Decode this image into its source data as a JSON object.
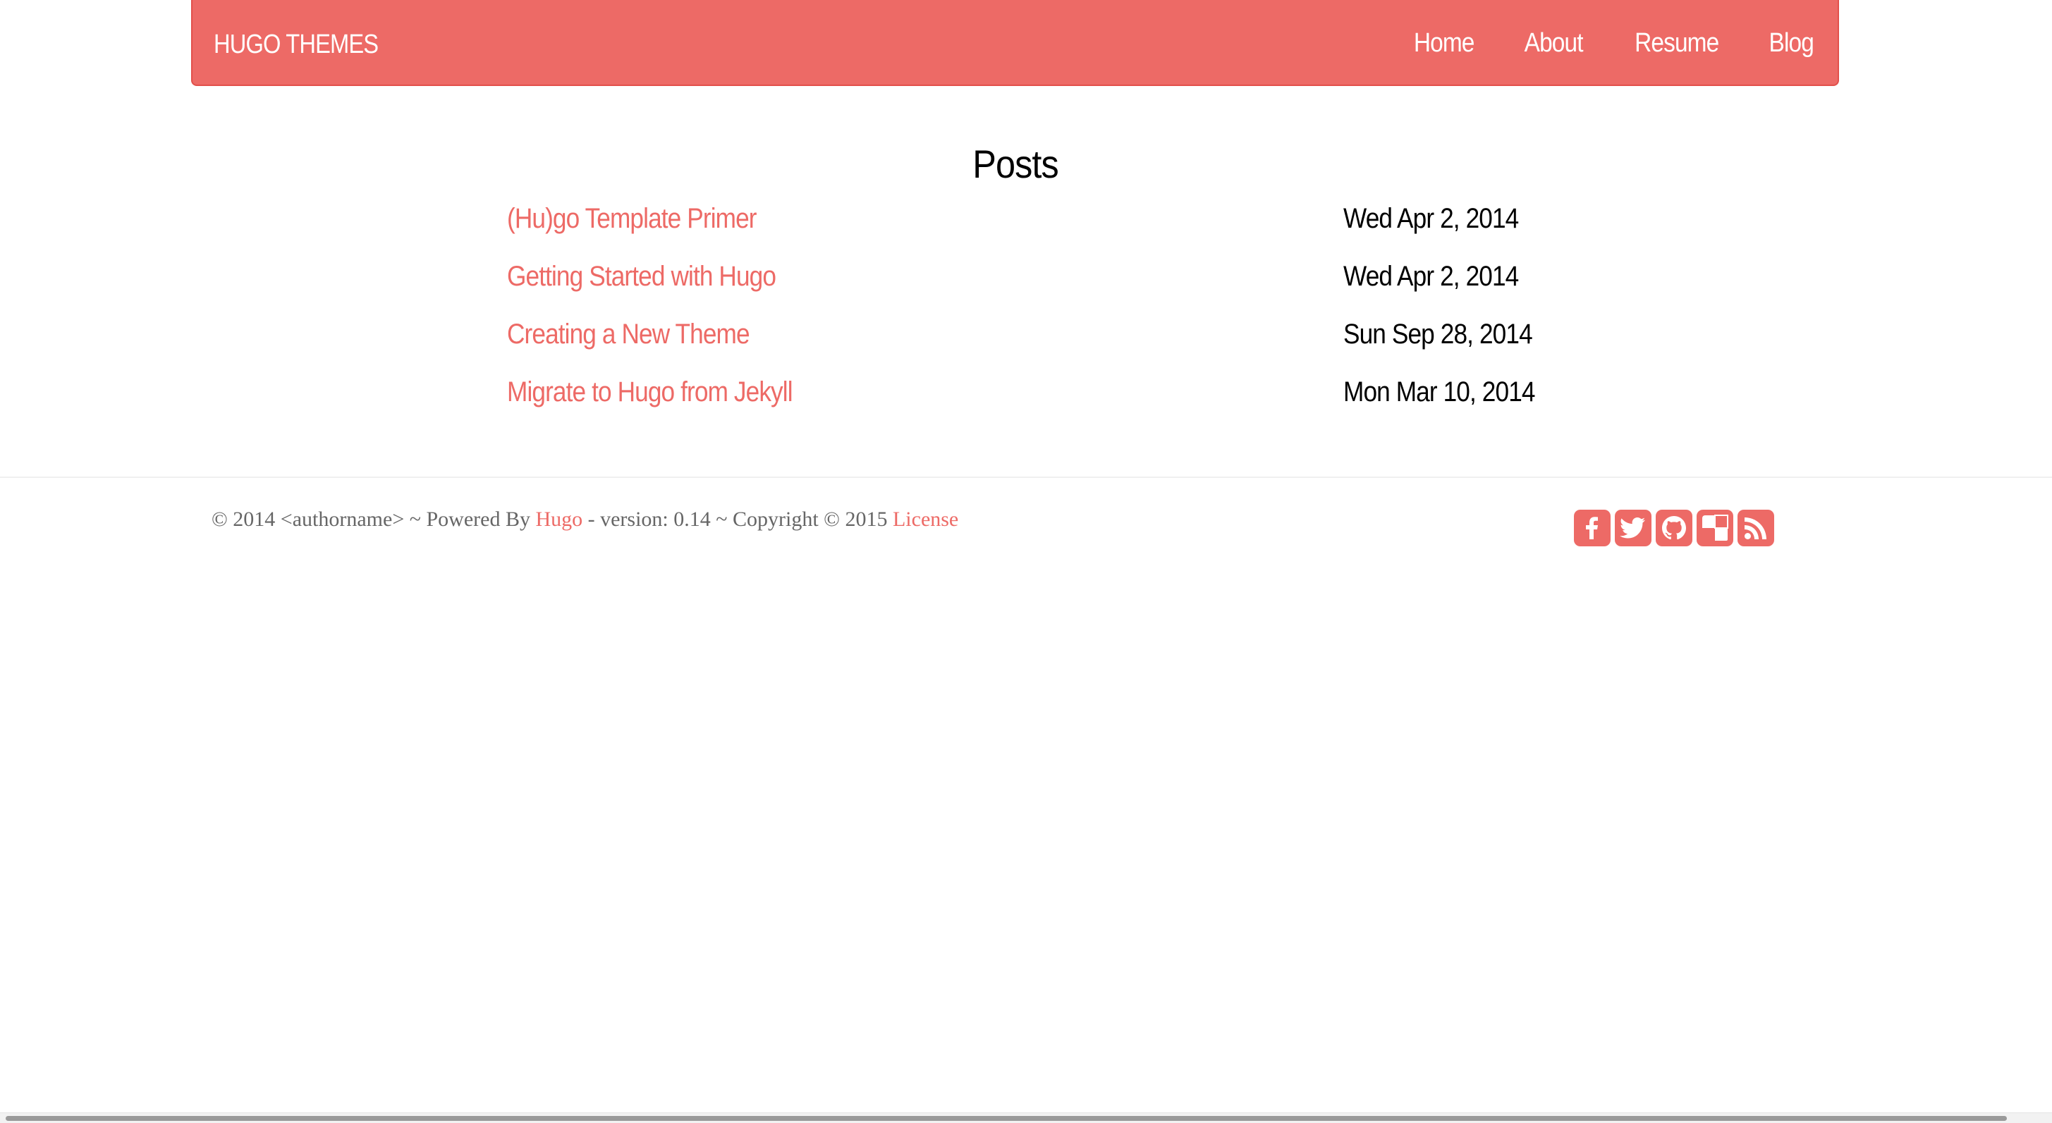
{
  "header": {
    "brand": "HUGO THEMES",
    "nav": [
      {
        "label": "Home"
      },
      {
        "label": "About"
      },
      {
        "label": "Resume"
      },
      {
        "label": "Blog"
      }
    ]
  },
  "main": {
    "title": "Posts",
    "posts": [
      {
        "title": "(Hu)go Template Primer",
        "date": "Wed Apr 2, 2014"
      },
      {
        "title": "Getting Started with Hugo",
        "date": "Wed Apr 2, 2014"
      },
      {
        "title": "Creating a New Theme",
        "date": "Sun Sep 28, 2014"
      },
      {
        "title": "Migrate to Hugo from Jekyll",
        "date": "Mon Mar 10, 2014"
      }
    ]
  },
  "footer": {
    "text_before": "© 2014 <authorname> ~ Powered By ",
    "hugo_link": "Hugo",
    "text_middle": " - version: 0.14 ~ Copyright © 2015 ",
    "license_link": "License",
    "social_icons": [
      "facebook-icon",
      "twitter-icon",
      "github-icon",
      "delicious-icon",
      "rss-icon"
    ]
  },
  "colors": {
    "accent": "#ed6a66",
    "text": "#000000",
    "footer_text": "#666666"
  }
}
